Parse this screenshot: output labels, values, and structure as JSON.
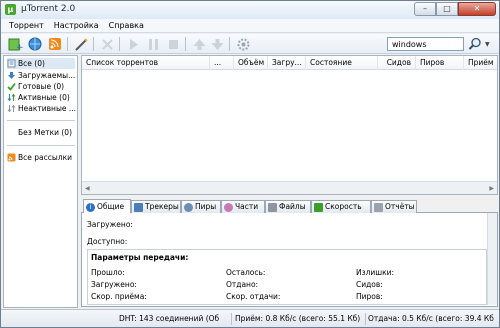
{
  "window": {
    "title": "µTorrent 2.0",
    "minimize": "–",
    "maximize": "□",
    "close": "✕"
  },
  "menu": [
    "Торрент",
    "Настройка",
    "Справка"
  ],
  "search": {
    "value": "windows"
  },
  "sidebar": {
    "items": [
      {
        "label": "Все (0)",
        "icon": "all-icon"
      },
      {
        "label": "Загружаемы...",
        "icon": "download-icon"
      },
      {
        "label": "Готовые (0)",
        "icon": "check-icon"
      },
      {
        "label": "Активные (0)",
        "icon": "active-icon"
      },
      {
        "label": "Неактивные ...",
        "icon": "inactive-icon"
      }
    ],
    "no_label": "Без Метки (0)",
    "rss": "Все рассылки"
  },
  "list": {
    "columns": [
      "Список торрентов",
      "...",
      "Объём",
      "Загру...",
      "Состояние",
      "Сидов",
      "Пиров",
      "Приём"
    ]
  },
  "tabs": [
    "Общие",
    "Трекеры",
    "Пиры",
    "Части",
    "Файлы",
    "Скорость",
    "Отчёты"
  ],
  "general": {
    "downloaded": "Загружено:",
    "available": "Доступно:",
    "params_title": "Параметры передачи:",
    "col1": [
      "Прошло:",
      "Загружено:",
      "Скор. приёма:"
    ],
    "col2": [
      "Осталось:",
      "Отдано:",
      "Скор. отдачи:"
    ],
    "col3": [
      "Излишки:",
      "Сидов:",
      "Пиров:"
    ]
  },
  "status": {
    "dht": "DHT: 143 соединений  (Об",
    "recv": "Приём: 0.8 Кб/с (всего: 55.1 Кб)",
    "send": "Отдача: 0.5 Кб/с (всего: 39.4 Кб)"
  }
}
